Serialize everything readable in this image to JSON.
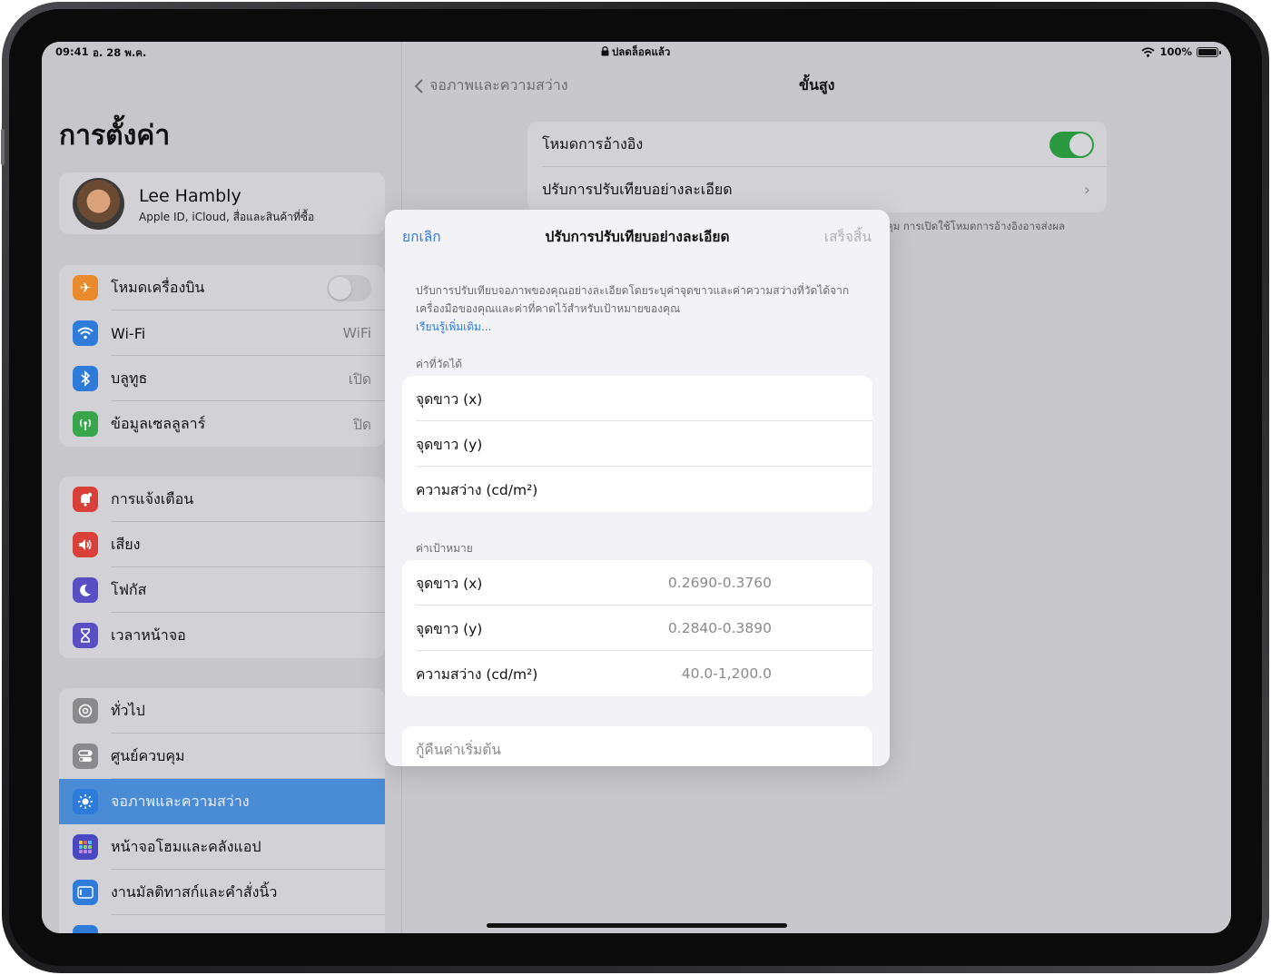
{
  "status_bar": {
    "time": "09:41",
    "date": "อ. 28 พ.ค.",
    "lock_text": "ปลดล็อคแล้ว",
    "battery": "100%"
  },
  "sidebar": {
    "title": "การตั้งค่า",
    "profile": {
      "name": "Lee Hambly",
      "subtitle": "Apple ID, iCloud, สื่อและสินค้าที่ซื้อ"
    },
    "group1": [
      {
        "label": "โหมดเครื่องบิน",
        "value": "",
        "icon": "airplane-icon",
        "color": "#e98a2c",
        "toggle": "off"
      },
      {
        "label": "Wi-Fi",
        "value": "WiFi",
        "icon": "wifi-icon",
        "color": "#2f7bd9"
      },
      {
        "label": "บลูทูธ",
        "value": "เปิด",
        "icon": "bluetooth-icon",
        "color": "#2f7bd9"
      },
      {
        "label": "ข้อมูลเซลลูลาร์",
        "value": "ปิด",
        "icon": "cellular-icon",
        "color": "#3aa64c"
      }
    ],
    "group2": [
      {
        "label": "การแจ้งเตือน",
        "icon": "bell-icon",
        "color": "#d9403a"
      },
      {
        "label": "เสียง",
        "icon": "speaker-icon",
        "color": "#d9403a"
      },
      {
        "label": "โฟกัส",
        "icon": "moon-icon",
        "color": "#5a4ec4"
      },
      {
        "label": "เวลาหน้าจอ",
        "icon": "hourglass-icon",
        "color": "#5a4ec4"
      }
    ],
    "group3": [
      {
        "label": "ทั่วไป",
        "icon": "gear-icon",
        "color": "#8a8a8e"
      },
      {
        "label": "ศูนย์ควบคุม",
        "icon": "switches-icon",
        "color": "#8a8a8e"
      },
      {
        "label": "จอภาพและความสว่าง",
        "icon": "sun-icon",
        "color": "#2f7bd9",
        "selected": true
      },
      {
        "label": "หน้าจอโฮมและคลังแอป",
        "icon": "grid-icon",
        "color": "#4a48c0"
      },
      {
        "label": "งานมัลติทาสก์และคำสั่งนิ้ว",
        "icon": "multitask-icon",
        "color": "#2f7bd9"
      }
    ]
  },
  "detail": {
    "back_label": "จอภาพและความสว่าง",
    "title": "ขั้นสูง",
    "rows": [
      {
        "label": "โหมดการอ้างอิง",
        "toggle": "on"
      },
      {
        "label": "ปรับการปรับเทียบอย่างละเอียด",
        "chevron": true
      }
    ],
    "footnote": "คุม การเปิดใช้โหมดการอ้างอิงอาจส่งผล"
  },
  "modal": {
    "cancel": "ยกเลิก",
    "title": "ปรับการปรับเทียบอย่างละเอียด",
    "done": "เสร็จสิ้น",
    "description": "ปรับการปรับเทียบจอภาพของคุณอย่างละเอียดโดยระบุค่าจุดขาวและค่าความสว่างที่วัดได้จากเครื่องมือของคุณและค่าที่คาดไว้สำหรับเป้าหมายของคุณ",
    "learn_more": "เรียนรู้เพิ่มเติม...",
    "measured_header": "ค่าที่วัดได้",
    "measured": [
      {
        "label": "จุดขาว (x)",
        "value": ""
      },
      {
        "label": "จุดขาว (y)",
        "value": ""
      },
      {
        "label": "ความสว่าง (cd/m²)",
        "value": ""
      }
    ],
    "target_header": "ค่าเป้าหมาย",
    "target": [
      {
        "label": "จุดขาว (x)",
        "value": "0.2690-0.3760"
      },
      {
        "label": "จุดขาว (y)",
        "value": "0.2840-0.3890"
      },
      {
        "label": "ความสว่าง (cd/m²)",
        "value": "40.0-1,200.0"
      }
    ],
    "reset": "กู้คืนค่าเริ่มต้น"
  }
}
